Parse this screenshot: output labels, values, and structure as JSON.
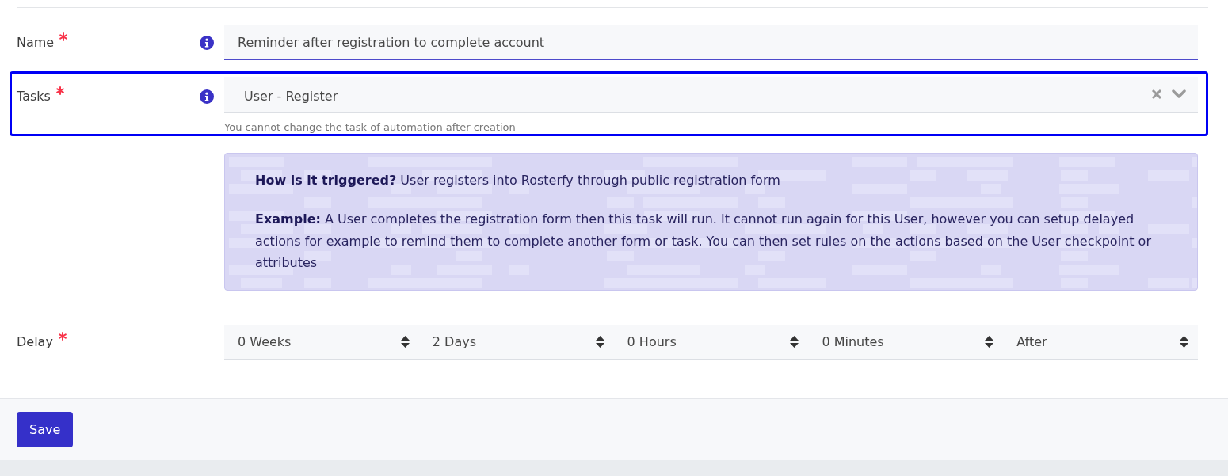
{
  "form": {
    "rows": [
      {
        "kind": "text",
        "label": "Name",
        "required": true,
        "info": true,
        "focused": true,
        "highlighted": false,
        "value": "Reminder after registration to complete account"
      },
      {
        "kind": "select",
        "label": "Tasks",
        "required": true,
        "info": true,
        "focused": false,
        "highlighted": true,
        "value": "User - Register",
        "clearable": true,
        "hint": "You cannot change the task of automation after creation"
      },
      {
        "kind": "note",
        "paragraphs": [
          "**How is it triggered?** User registers into Rosterfy through public registration form",
          "**Example:** A User completes the registration form then this task will run. It cannot run again for this User, however you can setup delayed actions for example to remind them to complete another form or task. You can then set rules on the actions based on the User checkpoint or attributes"
        ]
      },
      {
        "kind": "duration",
        "label": "Delay",
        "required": true,
        "info": false,
        "focused": false,
        "highlighted": false,
        "selects": [
          {
            "value": "0 Weeks"
          },
          {
            "value": "2 Days"
          },
          {
            "value": "0 Hours"
          },
          {
            "value": "0 Minutes"
          },
          {
            "value": "After"
          }
        ]
      }
    ]
  },
  "footer": {
    "button": "Save"
  }
}
